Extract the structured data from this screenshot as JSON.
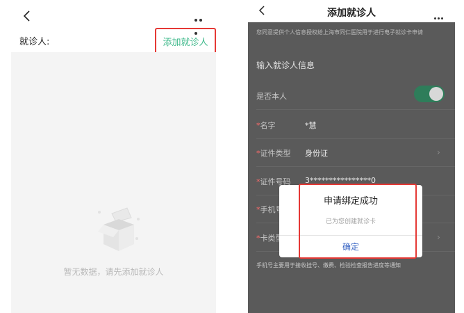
{
  "left": {
    "patient_label": "就诊人:",
    "add_button": "添加就诊人",
    "empty_text": "暂无数据，请先添加就诊人",
    "icons": {
      "back": "chevron-left-icon",
      "more": "more-horizontal-icon",
      "empty": "empty-box-icon"
    }
  },
  "right": {
    "title": "添加就诊人",
    "consent": "您同意提供个人信息授权给上海市同仁医院用于进行电子就诊卡申请",
    "section_title": "输入就诊人信息",
    "rows": [
      {
        "label": "是否本人",
        "required": false,
        "value": ""
      },
      {
        "label": "名字",
        "required": true,
        "value": "*慧"
      },
      {
        "label": "证件类型",
        "required": true,
        "value": "身份证"
      },
      {
        "label": "证件号码",
        "required": true,
        "value": "3****************0"
      },
      {
        "label": "手机号",
        "required": true,
        "value": ""
      },
      {
        "label": "卡类型",
        "required": true,
        "value": ""
      }
    ],
    "is_self_toggle_on": true,
    "hint": "手机号主要用于接收挂号、缴费、检验检查报告进度等通知",
    "dialog": {
      "title": "申请绑定成功",
      "message": "已为您创建就诊卡",
      "ok_label": "确定"
    }
  },
  "colors": {
    "accent_green": "#3fb98b",
    "highlight_red": "#e53935",
    "link_blue": "#3a66c4"
  }
}
